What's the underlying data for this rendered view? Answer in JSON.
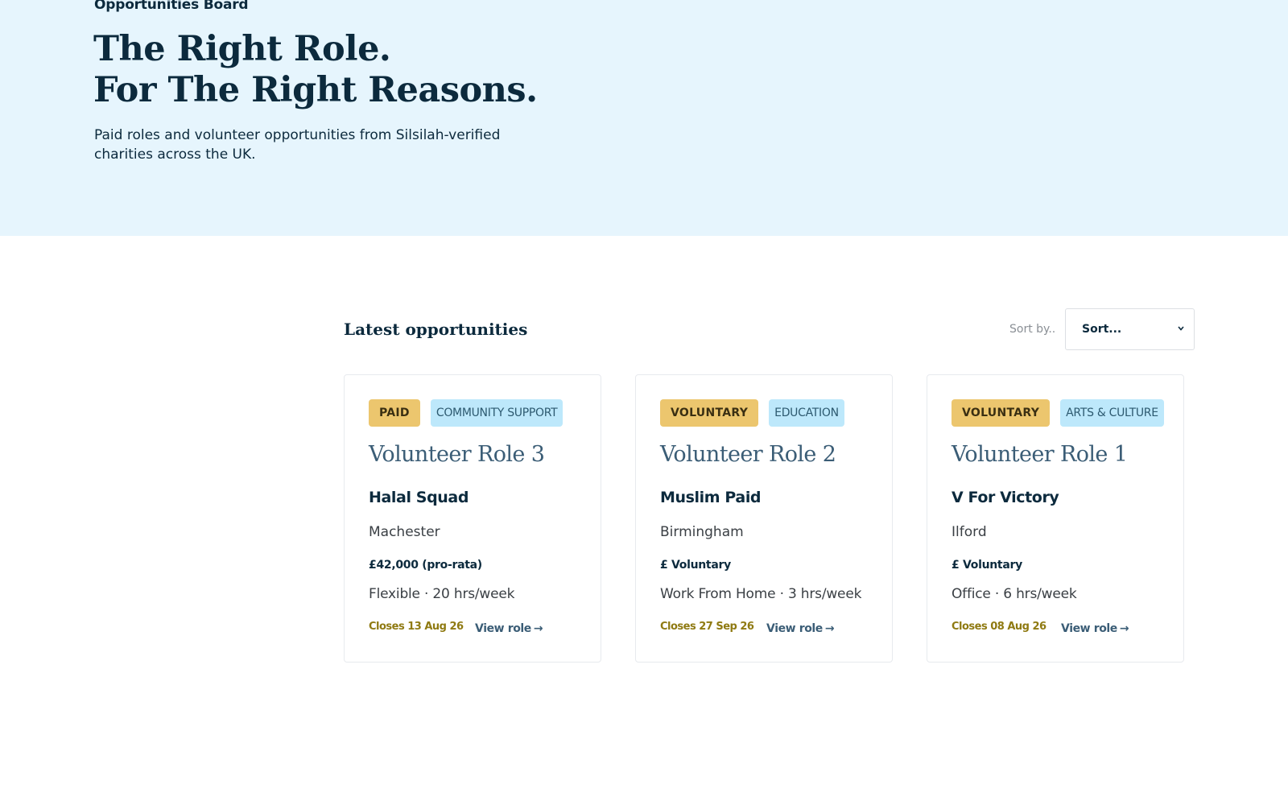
{
  "hero": {
    "eyebrow": "Opportunities Board",
    "title_line1": "The Right Role.",
    "title_line2": "For The Right Reasons.",
    "subtitle": "Paid roles and volunteer opportunities from Silsilah-verified charities across the UK."
  },
  "listing": {
    "section_title": "Latest opportunities",
    "sort_label": "Sort by..",
    "sort_value": "Sort..."
  },
  "cards": [
    {
      "type_tag": "PAID",
      "category_tag": "COMMUNITY SUPPORT",
      "title": "Volunteer Role 3",
      "organisation": "Halal Squad",
      "location": "Machester",
      "pay": "£42,000 (pro-rata)",
      "hours": "Flexible · 20 hrs/week",
      "closes": "Closes 13 Aug 26",
      "cta": "View role"
    },
    {
      "type_tag": "VOLUNTARY",
      "category_tag": "EDUCATION",
      "title": "Volunteer Role 2",
      "organisation": "Muslim Paid",
      "location": "Birmingham",
      "pay": "£ Voluntary",
      "hours": "Work From Home · 3 hrs/week",
      "closes": "Closes 27 Sep 26",
      "cta": "View role"
    },
    {
      "type_tag": "VOLUNTARY",
      "category_tag": "ARTS & CULTURE",
      "title": "Volunteer Role 1",
      "organisation": "V For Victory",
      "location": "Ilford",
      "pay": "£ Voluntary",
      "hours": "Office · 6 hrs/week",
      "closes": "Closes 08 Aug 26",
      "cta": "View role"
    }
  ],
  "colors": {
    "hero_background": "#e6f5fd",
    "type_tag": "#ecc66e",
    "category_tag": "#bde8fb",
    "closes_text": "#8f7a12",
    "role_title": "#3b5d76"
  },
  "icons": {
    "sort_chevron": "chevron-down-icon",
    "view_role_arrow": "arrow-right-icon"
  }
}
